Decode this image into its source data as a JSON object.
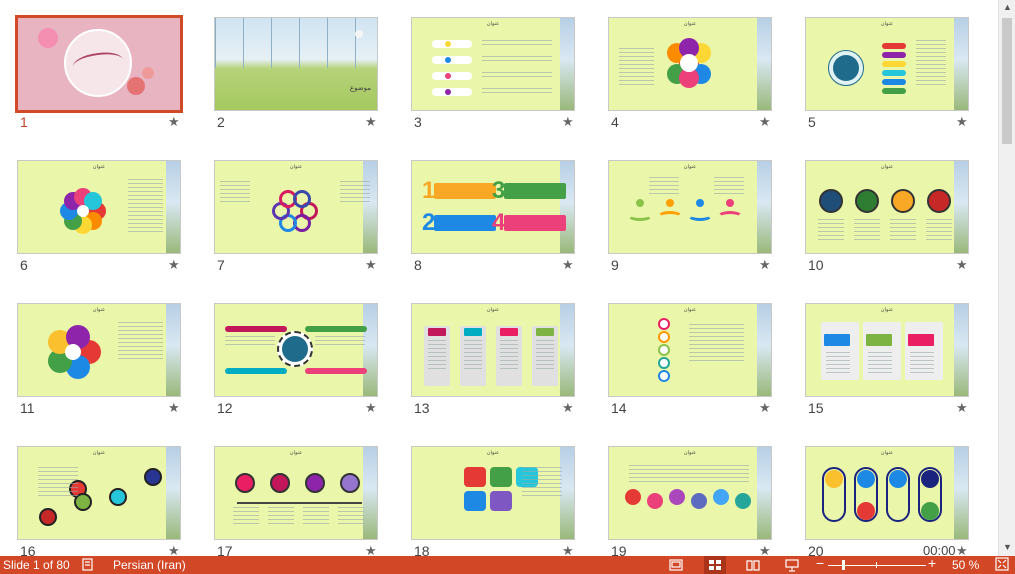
{
  "slides": [
    {
      "n": "1",
      "title": "",
      "selected": true,
      "kind": "cover"
    },
    {
      "n": "2",
      "title": "موضوع",
      "kind": "greenhouse"
    },
    {
      "n": "3",
      "title": "عنوان",
      "kind": "list"
    },
    {
      "n": "4",
      "title": "عنوان",
      "kind": "flower5"
    },
    {
      "n": "5",
      "title": "عنوان",
      "kind": "hub"
    },
    {
      "n": "6",
      "title": "عنوان",
      "kind": "petals"
    },
    {
      "n": "7",
      "title": "عنوان",
      "kind": "rings"
    },
    {
      "n": "8",
      "title": "",
      "kind": "numbers"
    },
    {
      "n": "9",
      "title": "عنوان",
      "kind": "wave"
    },
    {
      "n": "10",
      "title": "عنوان",
      "kind": "balls"
    },
    {
      "n": "11",
      "title": "عنوان",
      "kind": "spiral"
    },
    {
      "n": "12",
      "title": "",
      "kind": "bars"
    },
    {
      "n": "13",
      "title": "عنوان",
      "kind": "columns"
    },
    {
      "n": "14",
      "title": "عنوان",
      "kind": "chain"
    },
    {
      "n": "15",
      "title": "عنوان",
      "kind": "flags"
    },
    {
      "n": "16",
      "title": "عنوان",
      "kind": "bubbles"
    },
    {
      "n": "17",
      "title": "عنوان",
      "kind": "timeline"
    },
    {
      "n": "18",
      "title": "عنوان",
      "kind": "hex"
    },
    {
      "n": "19",
      "title": "عنوان",
      "kind": "tags"
    },
    {
      "n": "20",
      "title": "عنوان",
      "kind": "capsules",
      "time": "00:00"
    }
  ],
  "status": {
    "slide_info": "Slide 1 of 80",
    "language": "Persian (Iran)",
    "zoom": "50 %"
  },
  "colors": {
    "accent": "#d24726",
    "slide_bg": "#eaf6a9",
    "selected_border": "#d04a27"
  }
}
